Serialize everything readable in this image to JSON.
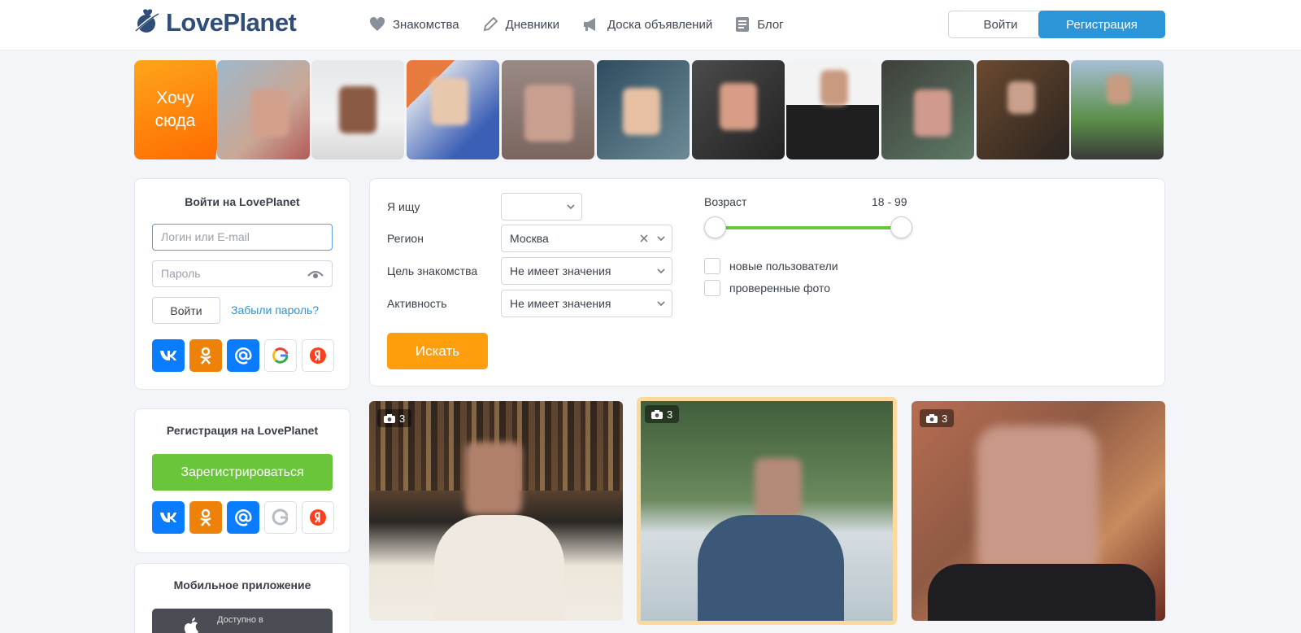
{
  "header": {
    "logo_text": "LovePlanet",
    "nav": [
      {
        "label": "Знакомства",
        "icon": "heart-icon"
      },
      {
        "label": "Дневники",
        "icon": "pencil-icon"
      },
      {
        "label": "Доска объявлений",
        "icon": "megaphone-icon"
      },
      {
        "label": "Блог",
        "icon": "document-icon"
      }
    ],
    "login_label": "Войти",
    "register_label": "Регистрация"
  },
  "strip": {
    "want_here": "Хочу сюда",
    "photo_count": 10
  },
  "login_panel": {
    "title": "Войти на LovePlanet",
    "login_placeholder": "Логин или E-mail",
    "password_placeholder": "Пароль",
    "submit_label": "Войти",
    "forgot_label": "Забыли пароль?",
    "social": [
      "vk-icon",
      "ok-icon",
      "mail-icon",
      "google-icon",
      "yandex-icon"
    ]
  },
  "register_panel": {
    "title": "Регистрация на LovePlanet",
    "submit_label": "Зарегистрироваться"
  },
  "mobile_panel": {
    "title": "Мобильное приложение",
    "appstore_small": "Доступно в"
  },
  "search": {
    "seeking_label": "Я ищу",
    "seeking_value": "",
    "region_label": "Регион",
    "region_value": "Москва",
    "goal_label": "Цель знакомства",
    "goal_value": "Не имеет значения",
    "activity_label": "Активность",
    "activity_value": "Не имеет значения",
    "age_label": "Возраст",
    "age_min": 18,
    "age_max": 99,
    "age_range_text": "18 - 99",
    "new_users_label": "новые пользователи",
    "verified_label": "проверенные фото",
    "search_label": "Искать"
  },
  "cards": [
    {
      "photos": "3"
    },
    {
      "photos": "3"
    },
    {
      "photos": "3"
    }
  ],
  "colors": {
    "brand_blue": "#2f4d78",
    "accent_blue": "#2b95d8",
    "orange": "#ff9e0d",
    "green": "#69c63a"
  }
}
